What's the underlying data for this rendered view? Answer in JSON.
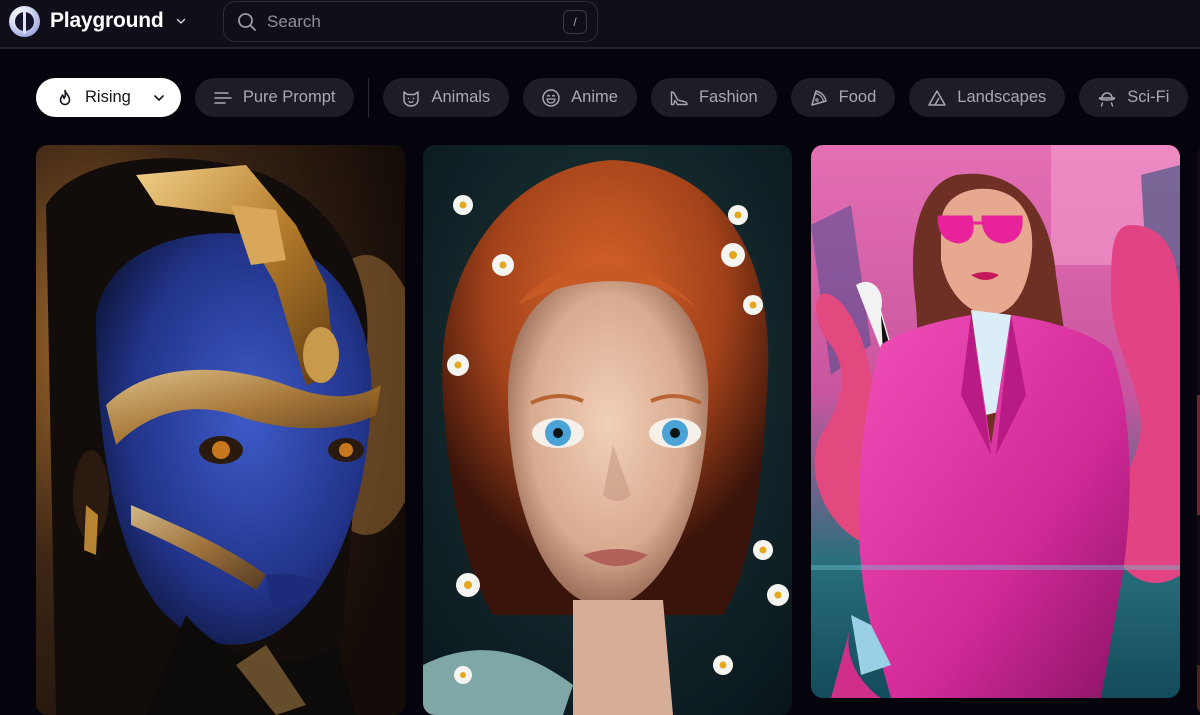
{
  "header": {
    "brand_name": "Playground",
    "brand_icon": "playground-logo-icon",
    "brand_menu_icon": "chevron-down-icon",
    "search": {
      "placeholder": "Search",
      "value": "",
      "icon": "search-icon",
      "shortcut_key": "/"
    }
  },
  "filters": {
    "sort": {
      "label": "Rising",
      "icon": "flame-icon",
      "dropdown_icon": "chevron-down-icon",
      "active": true
    },
    "chips": [
      {
        "label": "Pure Prompt",
        "icon": "lines-icon"
      },
      {
        "label": "Animals",
        "icon": "cat-face-icon"
      },
      {
        "label": "Anime",
        "icon": "smiley-face-icon"
      },
      {
        "label": "Fashion",
        "icon": "high-heel-icon"
      },
      {
        "label": "Food",
        "icon": "pizza-slice-icon"
      },
      {
        "label": "Landscapes",
        "icon": "mountain-icon"
      },
      {
        "label": "Sci-Fi",
        "icon": "ufo-icon"
      }
    ]
  },
  "gallery": {
    "images": [
      {
        "description": "Woman with blue face paint and gold ornamental headpiece"
      },
      {
        "description": "Red-haired freckled girl with blue eyes surrounded by daisies"
      },
      {
        "description": "Woman in pink suit and pink sunglasses with flamingos and palm trees"
      },
      {
        "description": "Partially visible image"
      }
    ]
  },
  "colors": {
    "background": "#05040d",
    "topbar": "#100f19",
    "chip_bg": "#1d1c27",
    "chip_text": "#a9a8b3",
    "active_chip_bg": "#ffffff"
  }
}
